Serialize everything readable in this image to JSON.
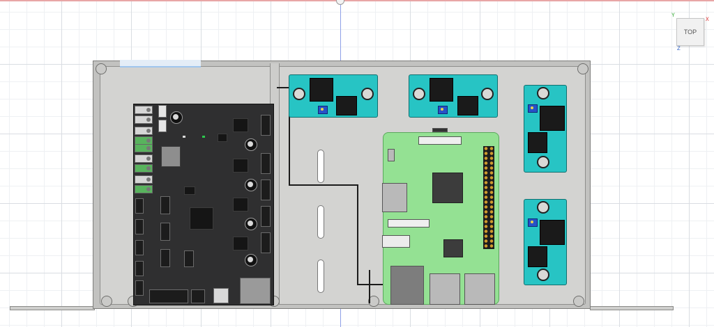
{
  "viewport": {
    "viewcube": {
      "face_label": "TOP",
      "axis_x": "X",
      "axis_y": "Y",
      "axis_z": "Z"
    }
  },
  "colors": {
    "enclosure": "#c2c2c0",
    "controller_board": "#2f2f30",
    "buck_converter": "#27c4c4",
    "raspberry_pi": "#94e193",
    "wire": "#1b1b1b",
    "origin_axis": "#8fa0e8"
  },
  "components": {
    "controller_label": "",
    "buck_converter_count": 4
  }
}
